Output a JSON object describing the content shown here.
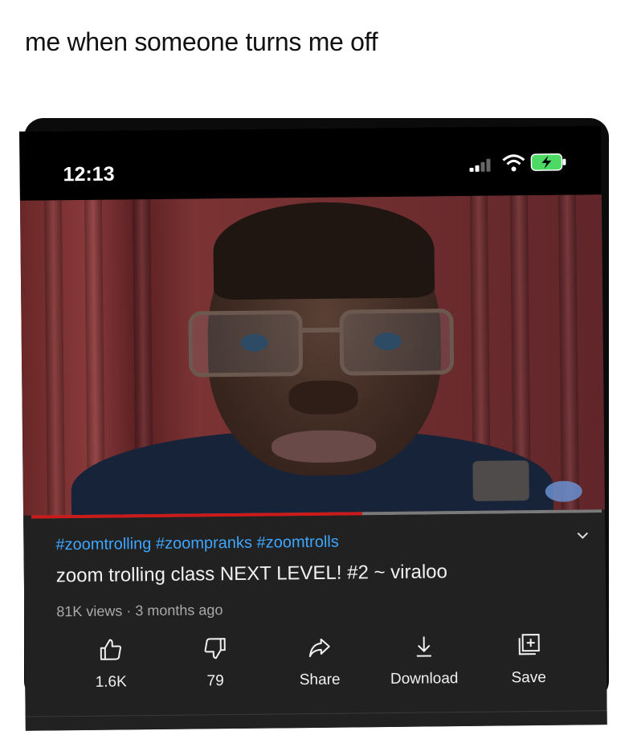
{
  "caption": "me when someone turns me off",
  "status_bar": {
    "time": "12:13",
    "signal_icon": "cellular-signal-icon",
    "wifi_icon": "wifi-icon",
    "battery_icon": "battery-charging-icon"
  },
  "video": {
    "progress": 0.58,
    "progress_color": "#cc1a1a",
    "hashtags": "#zoomtrolling #zoompranks #zoomtrolls",
    "title": "zoom trolling class NEXT LEVEL! #2 ~ viraloo",
    "views": "81K views",
    "age": "3 months ago",
    "meta_separator": " · "
  },
  "actions": [
    {
      "name": "like-button",
      "icon": "thumbs-up-icon",
      "label": "1.6K"
    },
    {
      "name": "dislike-button",
      "icon": "thumbs-down-icon",
      "label": "79"
    },
    {
      "name": "share-button",
      "icon": "share-arrow-icon",
      "label": "Share"
    },
    {
      "name": "download-button",
      "icon": "download-icon",
      "label": "Download"
    },
    {
      "name": "save-button",
      "icon": "add-to-playlist-icon",
      "label": "Save"
    }
  ],
  "colors": {
    "hashtag": "#3ea6ff",
    "background": "#212121",
    "text": "#f1f1f1",
    "muted": "#aaaaaa"
  }
}
